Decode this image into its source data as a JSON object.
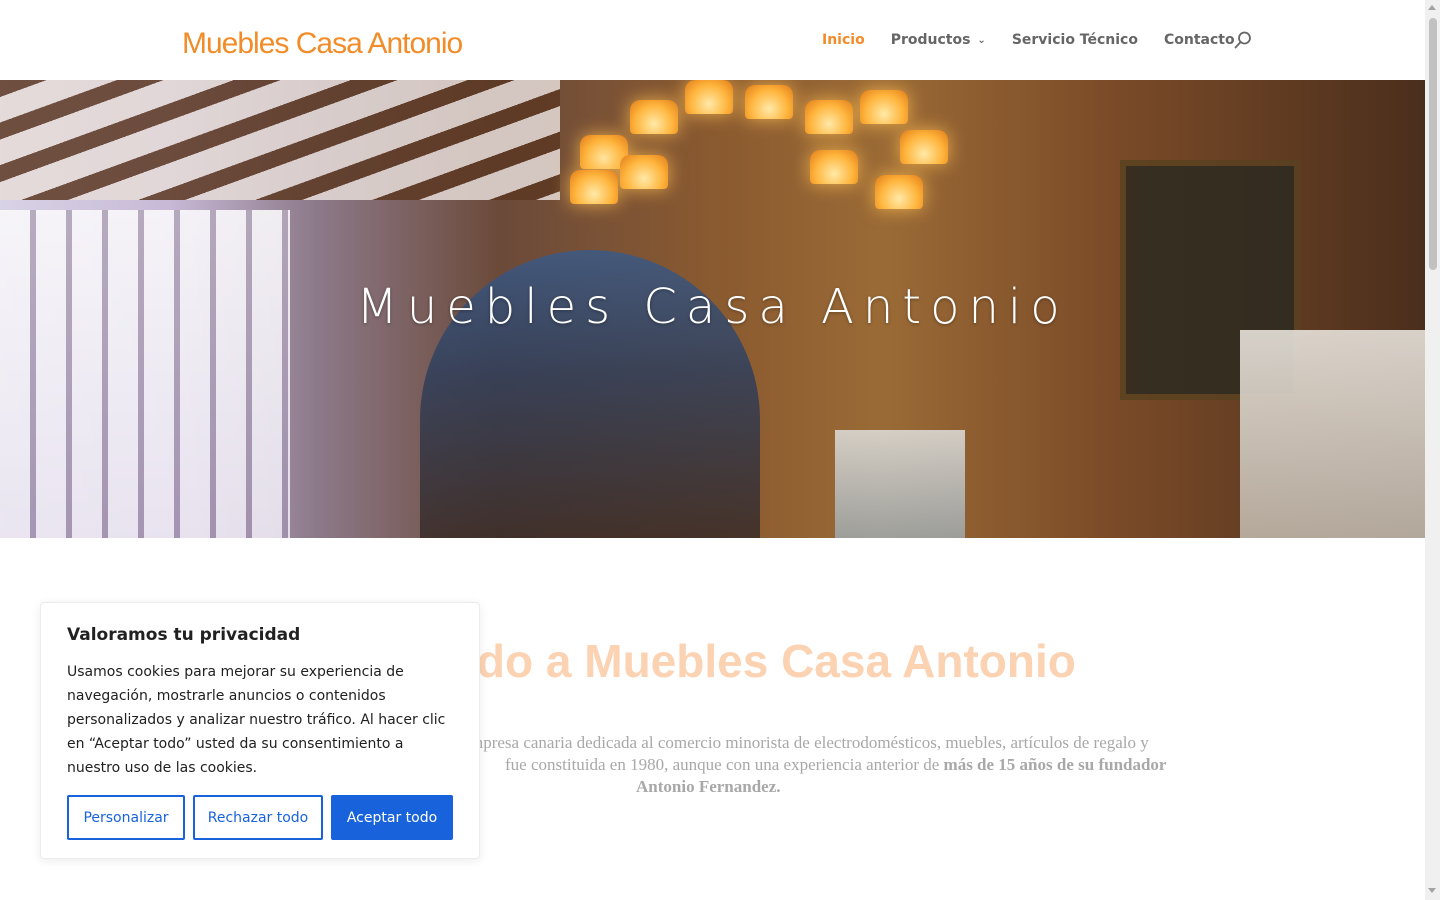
{
  "header": {
    "logo_text": "Muebles Casa Antonio",
    "nav": [
      {
        "label": "Inicio",
        "active": true
      },
      {
        "label": "Productos",
        "has_dropdown": true
      },
      {
        "label": "Servicio Técnico"
      },
      {
        "label": "Contacto"
      }
    ],
    "accent_color": "#f28c28"
  },
  "hero": {
    "title": "Muebles Casa Antonio"
  },
  "content": {
    "welcome_visible": "ido a Muebles Casa Antonio",
    "intro_line1": "mpresa canaria dedicada al comercio minorista de electrodomésticos, muebles, artículos de regalo y",
    "intro_line2_plain": "fue constituida en 1980, aunque con una experiencia anterior de ",
    "intro_line2_bold": "más de 15 años de su fundador",
    "intro_line3_bold": "Antonio Fernandez."
  },
  "cookie": {
    "title": "Valoramos tu privacidad",
    "body": "Usamos cookies para mejorar su experiencia de navegación, mostrarle anuncios o contenidos personalizados y analizar nuestro tráfico. Al hacer clic en “Aceptar todo” usted da su consentimiento a nuestro uso de las cookies.",
    "btn_customize": "Personalizar",
    "btn_reject": "Rechazar todo",
    "btn_accept": "Aceptar todo",
    "button_color": "#1863dc"
  }
}
